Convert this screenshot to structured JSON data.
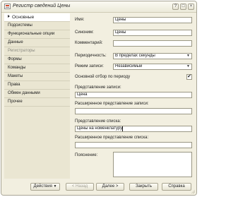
{
  "window": {
    "title": "Регистр сведений Цены",
    "icon": "register-icon"
  },
  "titlebar_buttons": {
    "help": "?",
    "restore": "□",
    "close": "×"
  },
  "sidebar": {
    "items": [
      {
        "label": "Основные",
        "selected": true
      },
      {
        "label": "Подсистемы"
      },
      {
        "label": "Функциональные опции"
      },
      {
        "label": "Данные"
      },
      {
        "label": "Регистраторы",
        "disabled": true
      },
      {
        "label": "Формы"
      },
      {
        "label": "Команды"
      },
      {
        "label": "Макеты"
      },
      {
        "label": "Права"
      },
      {
        "label": "Обмен данными"
      },
      {
        "label": "Прочее"
      }
    ]
  },
  "form": {
    "name_label": "Имя:",
    "name_value": "Цены",
    "synonym_label": "Синоним:",
    "synonym_value": "Цены",
    "comment_label": "Комментарий:",
    "comment_value": "",
    "periodicity_label": "Периодичность:",
    "periodicity_value": "В пределах секунды",
    "write_mode_label": "Режим записи:",
    "write_mode_value": "Независимый",
    "main_filter_label": "Основной отбор по периоду",
    "main_filter_checked": true,
    "record_presentation_label": "Представление записи:",
    "record_presentation_value": "Цена",
    "extended_record_presentation_label": "Расширенное представление записи:",
    "extended_record_presentation_value": "",
    "list_presentation_label": "Представление списка:",
    "list_presentation_value": "Цены на номенклатуру",
    "extended_list_presentation_label": "Расширенное представление списка:",
    "extended_list_presentation_value": "",
    "explanation_label": "Пояснение:",
    "explanation_value": ""
  },
  "buttons": {
    "actions": "Действия",
    "back": "< Назад",
    "next": "Далее >",
    "close": "Закрыть",
    "help": "Справка"
  }
}
